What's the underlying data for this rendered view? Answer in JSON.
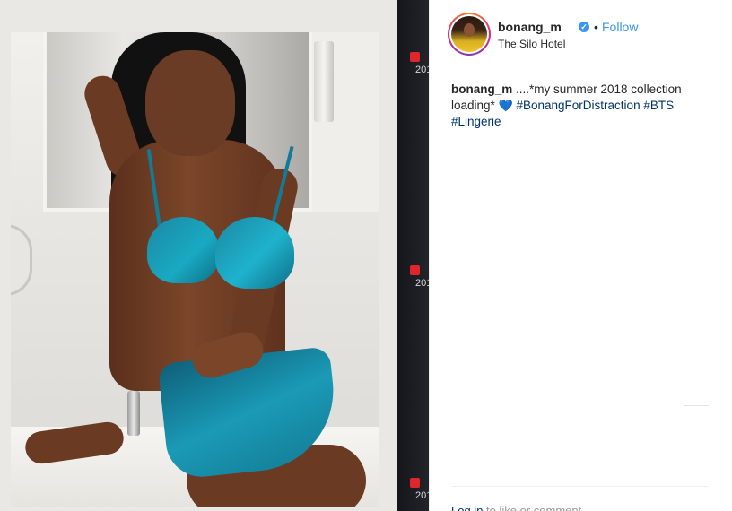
{
  "post": {
    "username": "bonang_m",
    "verified_mark": "✓",
    "separator": "•",
    "follow_label": "Follow",
    "location": "The Silo Hotel",
    "caption": {
      "user": "bonang_m",
      "text_before": " ....*my summer 2018 collection loading* ",
      "heart": "💙",
      "hashtags": [
        "#BonangForDistraction",
        "#BTS",
        "#Lingerie"
      ]
    },
    "login_prompt": {
      "link": "Log in",
      "rest": " to like or comment."
    }
  },
  "background": {
    "recording_labels": [
      "201",
      "201",
      "201"
    ]
  },
  "icons": {
    "verified": "verified-badge-icon",
    "heart": "blue-heart-icon",
    "recording": "record-dot-icon"
  },
  "colors": {
    "link_blue": "#3897f0",
    "hashtag_blue": "#003569",
    "text": "#262626",
    "record_red": "#e0262b",
    "lingerie_teal": "#19a9c2"
  }
}
